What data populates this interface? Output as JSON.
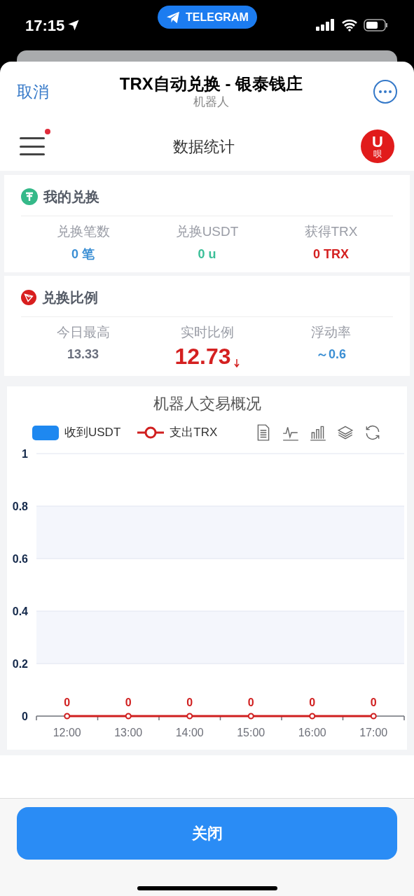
{
  "status_bar": {
    "time": "17:15",
    "pill": "TELEGRAM"
  },
  "sheet": {
    "cancel": "取消",
    "title": "TRX自动兑换 - 银泰钱庄",
    "subtitle": "机器人"
  },
  "nav": {
    "title": "数据统计",
    "menu_badge": true,
    "logo_text": "U",
    "logo_sub": "呗"
  },
  "my_exchange": {
    "title": "我的兑换",
    "stats": [
      {
        "label": "兑换笔数",
        "value": "0 笔",
        "color": "#3b8fd4"
      },
      {
        "label": "兑换USDT",
        "value": "0 u",
        "color": "#3bbf98"
      },
      {
        "label": "获得TRX",
        "value": "0 TRX",
        "color": "#d42020"
      }
    ]
  },
  "ratio": {
    "title": "兑换比例",
    "stats": [
      {
        "label": "今日最高",
        "value": "13.33",
        "kind": "plain"
      },
      {
        "label": "实时比例",
        "value": "12.73",
        "kind": "down"
      },
      {
        "label": "浮动率",
        "value": "～0.6",
        "kind": "rate"
      }
    ]
  },
  "chart": {
    "chart_data": {
      "type": "line",
      "title": "机器人交易概况",
      "categories": [
        "12:00",
        "13:00",
        "14:00",
        "15:00",
        "16:00",
        "17:00"
      ],
      "series": [
        {
          "name": "收到USDT",
          "color": "#1e88f0",
          "values": [
            null,
            null,
            null,
            null,
            null,
            null
          ]
        },
        {
          "name": "支出TRX",
          "color": "#d01f1f",
          "marker": "circle",
          "values": [
            0,
            0,
            0,
            0,
            0,
            0
          ]
        }
      ],
      "ylim": [
        0,
        1
      ],
      "yticks": [
        0,
        0.2,
        0.4,
        0.6,
        0.8,
        1
      ],
      "grid": true,
      "data_labels": true
    }
  },
  "close_button": "关闭"
}
